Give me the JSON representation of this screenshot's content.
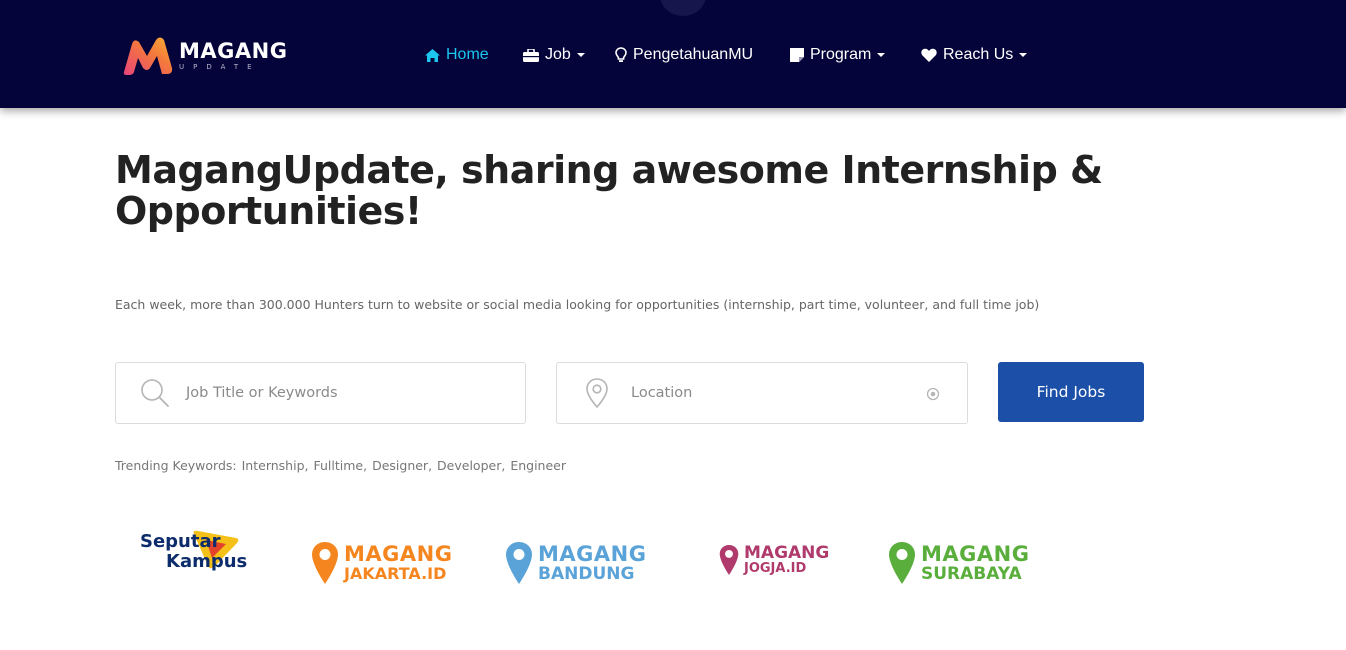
{
  "brand": {
    "name": "MAGANG",
    "sub": "UPDATE"
  },
  "nav": {
    "items": [
      {
        "label": "Home",
        "active": true,
        "dropdown": false,
        "icon": "home-icon"
      },
      {
        "label": "Job",
        "active": false,
        "dropdown": true,
        "icon": "briefcase-icon"
      },
      {
        "label": "PengetahuanMU",
        "active": false,
        "dropdown": false,
        "icon": "lightbulb-icon"
      },
      {
        "label": "Program",
        "active": false,
        "dropdown": true,
        "icon": "note-icon"
      },
      {
        "label": "Reach Us",
        "active": false,
        "dropdown": true,
        "icon": "heart-icon"
      }
    ]
  },
  "hero": {
    "title": "MagangUpdate, sharing awesome Internship & Opportunities!",
    "subtitle": "Each week, more than 300.000 Hunters turn to website or social media looking for opportunities (internship, part time, volunteer, and full time job)"
  },
  "search": {
    "keyword_placeholder": "Job Title or Keywords",
    "location_placeholder": "Location",
    "button_label": "Find Jobs"
  },
  "trending": {
    "label": "Trending Keywords:",
    "keywords": [
      "Internship,",
      "Fulltime,",
      "Designer,",
      "Developer,",
      "Engineer"
    ]
  },
  "partners": [
    {
      "line1": "Seputar",
      "line2": "Kampus",
      "color": "#0d2c6b"
    },
    {
      "line1": "MAGANG",
      "line2": "JAKARTA.ID",
      "color": "#f5861f"
    },
    {
      "line1": "MAGANG",
      "line2": "BANDUNG",
      "color": "#5aa3d8"
    },
    {
      "line1": "MAGANG",
      "line2": "JOGJA.ID",
      "color": "#b03a6b"
    },
    {
      "line1": "MAGANG",
      "line2": "SURABAYA",
      "color": "#5aae3c"
    }
  ],
  "colors": {
    "navbar_bg": "#04043a",
    "nav_active": "#1cc6ef",
    "button_bg": "#1b4fa8",
    "title_text": "#222222"
  }
}
